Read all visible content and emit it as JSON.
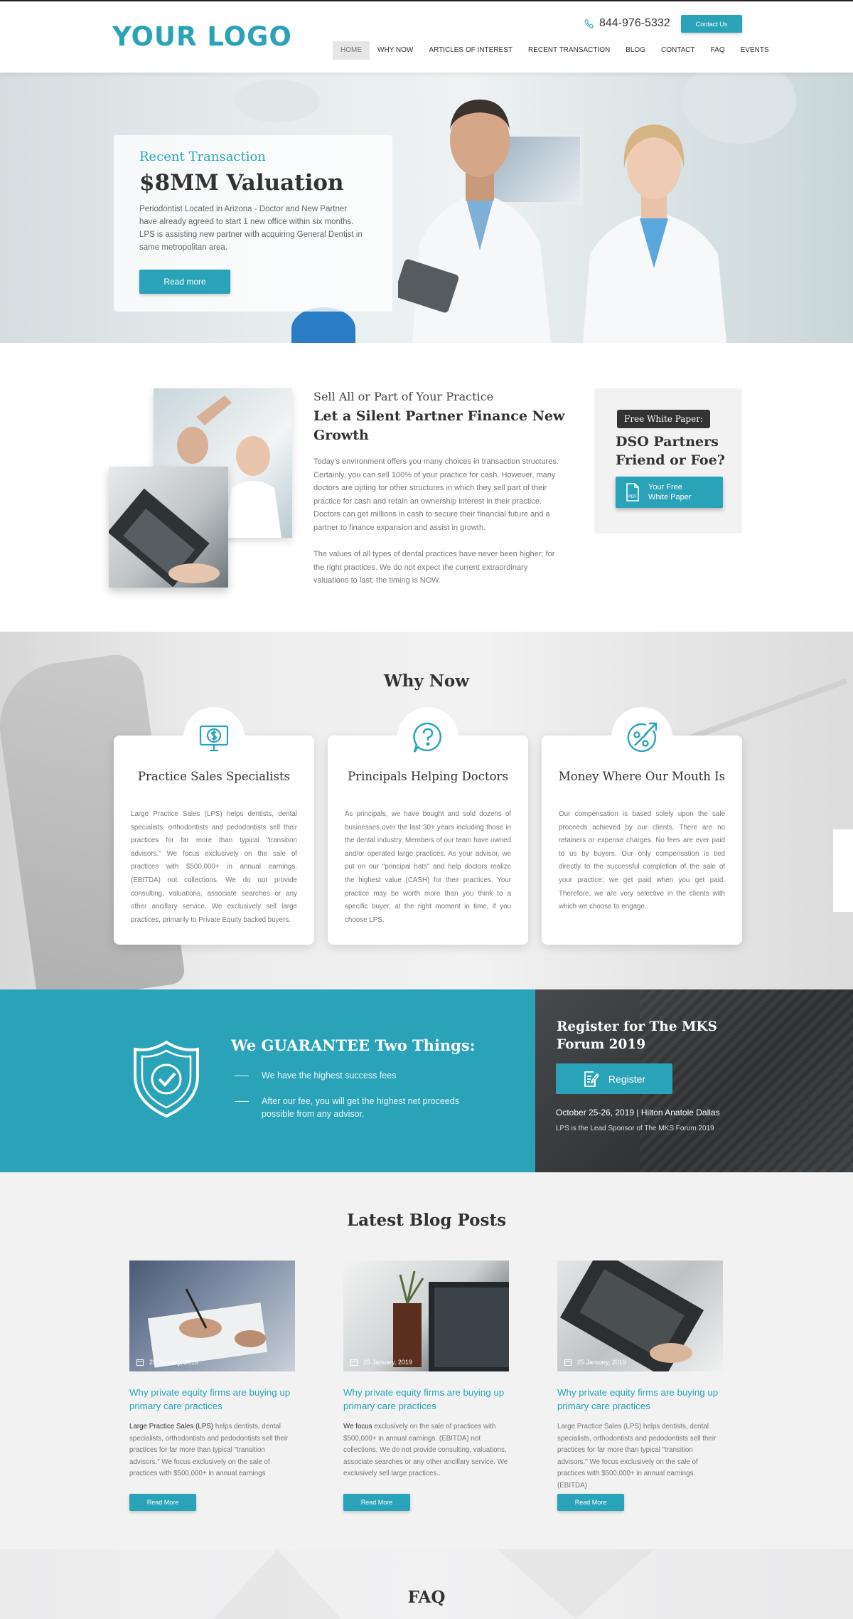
{
  "header": {
    "logo": "YOUR LOGO",
    "phone": "844-976-5332",
    "contact_label": "Contact Us",
    "nav": [
      "HOME",
      "WHY NOW",
      "ARTICLES OF INTEREST",
      "RECENT TRANSACTION",
      "BLOG",
      "CONTACT",
      "FAQ",
      "EVENTS"
    ],
    "active_nav": "HOME"
  },
  "hero": {
    "kicker": "Recent Transaction",
    "title": "$8MM Valuation",
    "text": "Periodontist Located in Arizona - Doctor and New Partner have already agreed to start 1 new office within six months. LPS is assisting new partner with acquiring General Dentist in same metropolitan area.",
    "button": "Read more"
  },
  "intro": {
    "kicker": "Sell All or Part of Your Practice",
    "title": "Let a Silent Partner Finance New Growth",
    "p1": "Today's environment offers you many choices in transaction structures. Certainly, you can sell 100% of your practice for cash. However, many doctors are opting for other structures in which they sell part of their practice for cash and retain an ownership interest in their practice. Doctors can get millions in cash to secure their financial future and a partner to finance expansion and assist in growth.",
    "p2": "The values of all types of dental practices have never been higher; for the right practices. We do not expect the current extraordinary valuations to last; the timing is NOW.",
    "white_paper": {
      "tag": "Free White Paper:",
      "title": "DSO Partners Friend or Foe?",
      "button": "Your Free White Paper"
    }
  },
  "why": {
    "title": "Why Now",
    "cards": [
      {
        "title": "Practice Sales Specialists",
        "icon": "monitor-dollar-icon",
        "text": "Large Practice Sales (LPS) helps dentists, dental specialists, orthodontists and pedodontists sell their practices for far more than typical \"transition advisors.\" We focus exclusively on the sale of practices with $500,000+ in annual earnings. (EBITDA) not collections. We do not provide consulting, valuations, associate searches or any other ancillary service. We exclusively sell large practices, primarily to Private Equity backed buyers."
      },
      {
        "title": "Principals Helping Doctors",
        "icon": "question-bubble-icon",
        "text": "As principals, we have bought and sold dozens of businesses over the last 30+ years including those in the dental industry. Members of our team have owned and/or operated large practices. As your advisor, we put on our \"principal hats\" and help doctors realize the highest value (CASH) for their practices. Your practice may be worth more than you think to a specific buyer, at the right moment in time, if you choose LPS."
      },
      {
        "title": "Money Where Our Mouth Is",
        "icon": "percent-growth-icon",
        "text": "Our compensation is based solely upon the sale proceeds achieved by our clients. There are no retainers or expense charges. No fees are ever paid to us by buyers. Our only compensation is tied directly to the successful completion of the sale of your practice; we get paid when you get paid. Therefore, we are very selective in the clients with which we choose to engage."
      }
    ]
  },
  "guarantee": {
    "title": "We GUARANTEE Two Things:",
    "items": [
      "We have the highest success fees",
      "After our fee, you will get the highest net proceeds possible from any advisor."
    ]
  },
  "forum": {
    "title": "Register for The MKS Forum 2019",
    "button": "Register",
    "date": "October 25-26, 2019  |  Hilton Anatole Dallas",
    "sponsor": "LPS is the Lead Sponsor of The MKS Forum 2019"
  },
  "blog": {
    "title": "Latest Blog Posts",
    "posts": [
      {
        "date": "25 January, 2019",
        "title": "Why private equity firms are buying up primary care practices",
        "text_bold": "Large Practice Sales (LPS)",
        "text": " helps dentists, dental specialists, orthodontists and pedodontists sell their practices for far more than typical \"transition advisors.\" We focus exclusively on the sale of practices with $500,000+ in annual earnings",
        "button": "Read More"
      },
      {
        "date": "25 January, 2019",
        "title": "Why private equity firms are buying up primary care practices",
        "text_bold": "We focus",
        "text": " exclusively on the sale of practices with $500,000+ in annual earnings. (EBITDA) not collections. We do not provide consulting, valuations, associate searches or any other ancillary service. We exclusively sell large practices..",
        "button": "Read More"
      },
      {
        "date": "25 January, 2019",
        "title": "Why private equity firms are buying up primary care practices",
        "text_bold": "",
        "text": "Large Practice Sales (LPS) helps dentists, dental specialists, orthodontists and pedodontists sell their practices for far more than typical \"transition advisors.\" We focus exclusively on the sale of practices with $500,000+ in annual earnings. (EBITDA)",
        "button": "Read More"
      }
    ]
  },
  "faq": {
    "title": "FAQ"
  },
  "colors": {
    "accent": "#2aa3b9",
    "dark": "#333333",
    "forum_bg": "#3a3c3e"
  }
}
